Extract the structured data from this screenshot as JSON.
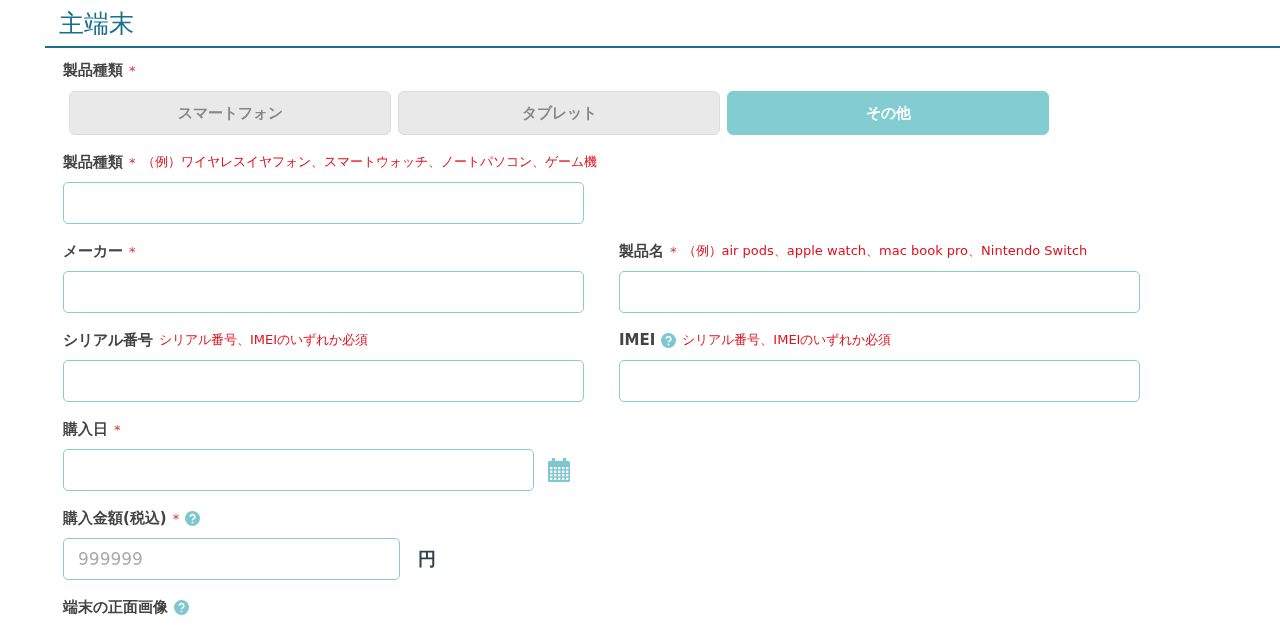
{
  "section_title": "主端末",
  "rows": [
    {
      "fields": [
        {
          "kind": "segmented",
          "label": "製品種類",
          "required_mark": "*",
          "options": [
            {
              "label": "スマートフォン",
              "selected": false
            },
            {
              "label": "タブレット",
              "selected": false
            },
            {
              "label": "その他",
              "selected": true
            }
          ]
        }
      ]
    },
    {
      "fields": [
        {
          "kind": "text",
          "label": "製品種類",
          "required_mark": "*",
          "note": "（例）ワイヤレスイヤフォン、スマートウォッチ、ノートパソコン、ゲーム機"
        }
      ]
    },
    {
      "fields": [
        {
          "kind": "text",
          "label": "メーカー",
          "required_mark": "*"
        },
        {
          "kind": "text",
          "label": "製品名",
          "required_mark": "*",
          "note": "（例）air pods、apple watch、mac book pro、Nintendo Switch"
        }
      ]
    },
    {
      "fields": [
        {
          "kind": "text",
          "label": "シリアル番号",
          "note": "シリアル番号、IMEIのいずれか必須"
        },
        {
          "kind": "text",
          "label": "IMEI",
          "help": true,
          "note": "シリアル番号、IMEIのいずれか必須"
        }
      ]
    },
    {
      "fields": [
        {
          "kind": "date",
          "label": "購入日",
          "required_mark": "*"
        }
      ]
    },
    {
      "fields": [
        {
          "kind": "price",
          "label": "購入金額(税込)",
          "required_mark": "*",
          "help": true,
          "placeholder": "999999",
          "unit": "円"
        }
      ]
    },
    {
      "fields": [
        {
          "kind": "label_only",
          "label": "端末の正面画像",
          "help": true
        }
      ]
    }
  ]
}
